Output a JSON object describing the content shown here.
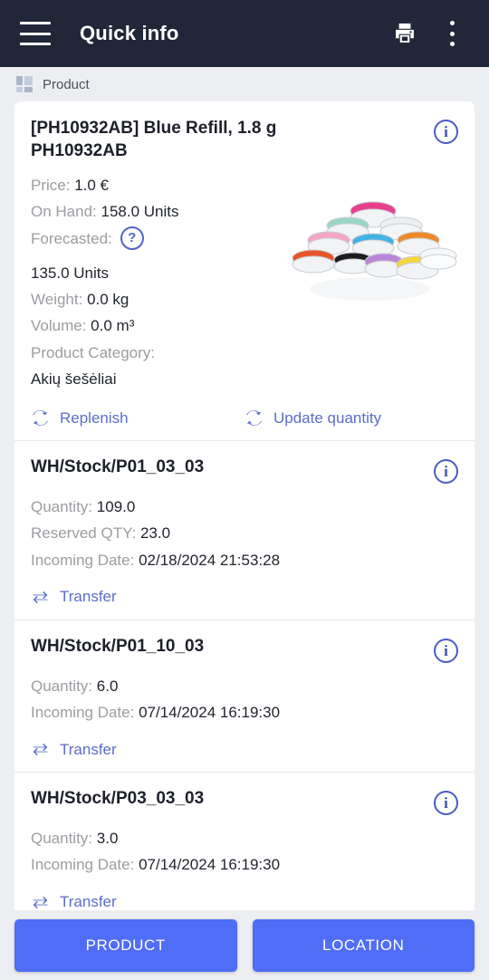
{
  "appbar": {
    "title": "Quick info",
    "menu_icon": "hamburger-icon",
    "print_icon": "printer-icon",
    "overflow_icon": "kebab-menu-icon"
  },
  "breadcrumb": {
    "icon": "grid-icon",
    "label": "Product"
  },
  "product": {
    "title": "[PH10932AB] Blue Refill, 1.8 g PH10932AB",
    "info_icon": "info-icon",
    "help_icon": "help-circle-icon",
    "image_alt": "cosmetic-jars-photo",
    "fields": {
      "price_label": "Price:",
      "price_value": "1.0 €",
      "on_hand_label": "On Hand:",
      "on_hand_value": "158.0 Units",
      "forecasted_label": "Forecasted:",
      "forecasted_value": "135.0 Units",
      "weight_label": "Weight:",
      "weight_value": "0.0 kg",
      "volume_label": "Volume:",
      "volume_value": "0.0 m³",
      "category_label": "Product Category:",
      "category_value": "Akių šešėliai"
    },
    "actions": {
      "replenish": "Replenish",
      "update_quantity": "Update quantity",
      "replenish_icon": "refresh-icon",
      "update_quantity_icon": "refresh-icon"
    }
  },
  "locations": [
    {
      "name": "WH/Stock/P01_03_03",
      "info_icon": "info-icon",
      "quantity_label": "Quantity:",
      "quantity_value": "109.0",
      "reserved_label": "Reserved QTY:",
      "reserved_value": "23.0",
      "incoming_label": "Incoming Date:",
      "incoming_value": "02/18/2024 21:53:28",
      "transfer_label": "Transfer",
      "transfer_icon": "transfer-arrows-icon"
    },
    {
      "name": "WH/Stock/P01_10_03",
      "info_icon": "info-icon",
      "quantity_label": "Quantity:",
      "quantity_value": "6.0",
      "incoming_label": "Incoming Date:",
      "incoming_value": "07/14/2024 16:19:30",
      "transfer_label": "Transfer",
      "transfer_icon": "transfer-arrows-icon"
    },
    {
      "name": "WH/Stock/P03_03_03",
      "info_icon": "info-icon",
      "quantity_label": "Quantity:",
      "quantity_value": "3.0",
      "incoming_label": "Incoming Date:",
      "incoming_value": "07/14/2024 16:19:30",
      "transfer_label": "Transfer",
      "transfer_icon": "transfer-arrows-icon"
    }
  ],
  "bottom_tabs": {
    "product": "PRODUCT",
    "location": "LOCATION"
  },
  "colors": {
    "appbar_bg": "#212738",
    "page_bg": "#eceef1",
    "card_bg": "#ffffff",
    "link": "#5b6ec8",
    "accent_button": "#4f6df5",
    "label_text": "#9c9ca2",
    "value_text": "#22252e"
  }
}
